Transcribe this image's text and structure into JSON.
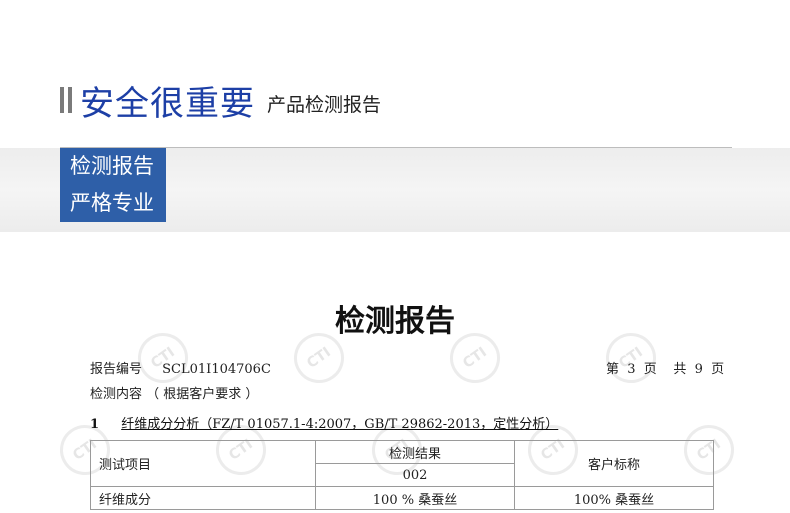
{
  "header": {
    "title": "安全很重要",
    "subtitle": "产品检测报告"
  },
  "banner": {
    "line1": "检测报告",
    "line2": "严格专业"
  },
  "document": {
    "title": "检测报告",
    "report_no_label": "报告编号",
    "report_no": "SCL01I104706C",
    "page_info": "第  3  页    共  9  页",
    "content_label": "检测内容 （ 根据客户要求 ）",
    "section_num": "1",
    "section_title": "纤维成分分析（FZ/T 01057.1-4:2007，GB/T 29862-2013，定性分析）",
    "table": {
      "col_item": "测试项目",
      "col_result": "检测结果",
      "sample_no": "002",
      "col_label": "客户标称",
      "row_item": "纤维成分",
      "row_result": "100 %  桑蚕丝",
      "row_label": "100%  桑蚕丝"
    },
    "watermark": "CTI"
  }
}
